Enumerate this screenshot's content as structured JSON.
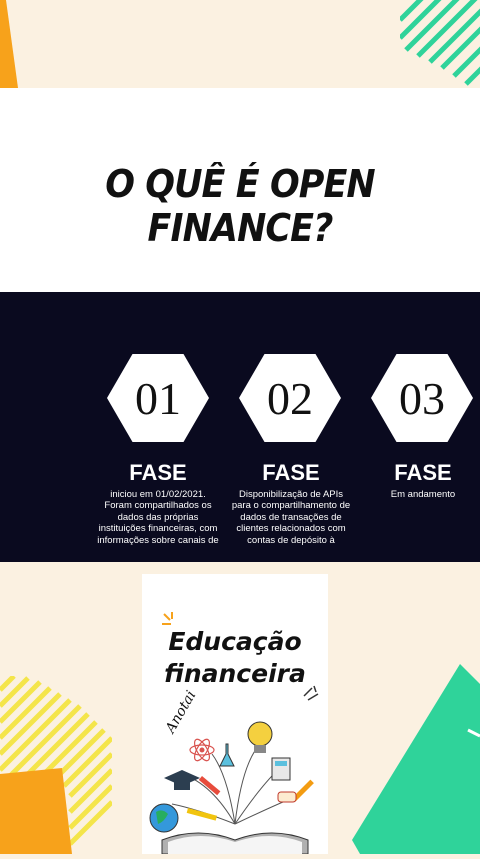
{
  "title": "O QUÊ É OPEN FINANCE?",
  "phases": [
    {
      "number": "01",
      "label": "FASE",
      "description": "iniciou em 01/02/2021. Foram compartilhados os dados das próprias instituições financeiras, com informações sobre canais de"
    },
    {
      "number": "02",
      "label": "FASE",
      "description": "Disponibilização de APIs para o compartilhamento de dados de transações de clientes relacionados com contas de depósito à"
    },
    {
      "number": "03",
      "label": "FASE",
      "description": "Em andamento"
    }
  ],
  "book_card": {
    "title_line1": "Educação",
    "title_line2": "financeira",
    "handwritten_note": "Anotai"
  },
  "colors": {
    "background": "#fbf1e1",
    "dark_band": "#0a0a1f",
    "green_accent": "#2fd39a",
    "yellow_stripes": "#f4e54a",
    "orange": "#f7a21b"
  }
}
